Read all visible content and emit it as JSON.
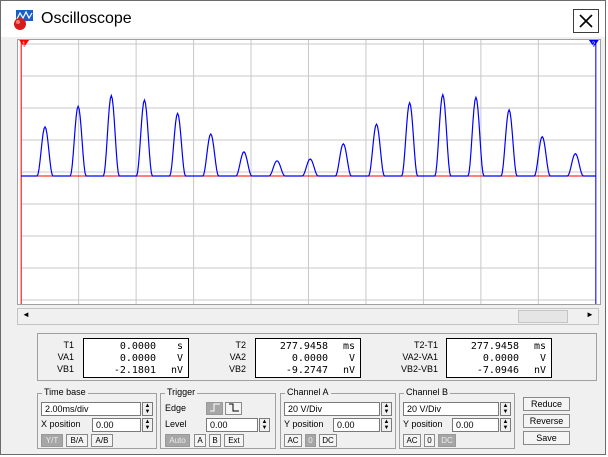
{
  "window": {
    "title": "Oscilloscope",
    "close_glyph": "✕"
  },
  "screen": {
    "cursor1_label": "1",
    "cursor2_label": "2",
    "trace_color": "#0000ff",
    "baseline_color": "#ff0000",
    "grid_color": "#c8c8c8",
    "peaks": [
      0.55,
      0.78,
      0.9,
      0.85,
      0.7,
      0.47,
      0.27,
      0.17,
      0.19,
      0.36,
      0.58,
      0.82,
      0.91,
      0.88,
      0.74,
      0.44,
      0.25
    ]
  },
  "scrollbar": {
    "left_arrow": "◄",
    "right_arrow": "►"
  },
  "measure": {
    "t1": {
      "label": "T1",
      "value": "0.0000",
      "unit": "s"
    },
    "va1": {
      "label": "VA1",
      "value": "0.0000",
      "unit": "V"
    },
    "vb1": {
      "label": "VB1",
      "value": "-2.1801",
      "unit": "nV"
    },
    "t2": {
      "label": "T2",
      "value": "277.9458",
      "unit": "ms"
    },
    "va2": {
      "label": "VA2",
      "value": "0.0000",
      "unit": "V"
    },
    "vb2": {
      "label": "VB2",
      "value": "-9.2747",
      "unit": "nV"
    },
    "t21": {
      "label": "T2-T1",
      "value": "277.9458",
      "unit": "ms"
    },
    "va21": {
      "label": "VA2-VA1",
      "value": "0.0000",
      "unit": "V"
    },
    "vb21": {
      "label": "VB2-VB1",
      "value": "-7.0946",
      "unit": "nV"
    }
  },
  "timebase": {
    "title": "Time base",
    "scale": "2.00ms/div",
    "xpos_label": "X position",
    "xpos": "0.00",
    "yt": "Y/T",
    "ba": "B/A",
    "ab": "A/B"
  },
  "trigger": {
    "title": "Trigger",
    "edge_label": "Edge",
    "level_label": "Level",
    "level": "0.00",
    "auto": "Auto",
    "a": "A",
    "b": "B",
    "ext": "Ext"
  },
  "channel_a": {
    "title": "Channel A",
    "scale": "20 V/Div",
    "ypos_label": "Y position",
    "ypos": "0.00",
    "ac": "AC",
    "zero": "0",
    "dc": "DC"
  },
  "channel_b": {
    "title": "Channel B",
    "scale": "20 V/Div",
    "ypos_label": "Y position",
    "ypos": "0.00",
    "ac": "AC",
    "zero": "0",
    "dc": "DC"
  },
  "buttons": {
    "reduce": "Reduce",
    "reverse": "Reverse",
    "save": "Save"
  },
  "spin_up": "▲",
  "spin_down": "▼"
}
